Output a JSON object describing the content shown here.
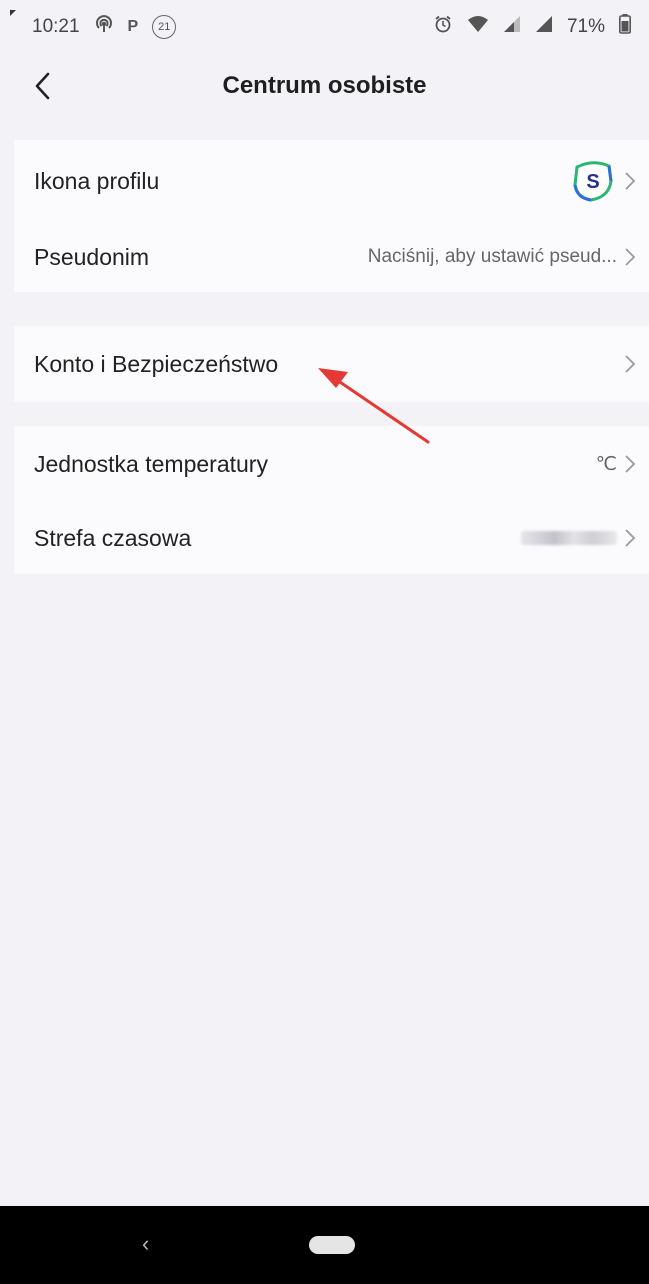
{
  "status_bar": {
    "time": "10:21",
    "left_icons": [
      "wifi-tethering-icon",
      "p-icon",
      "notification-21-icon"
    ],
    "p_glyph": "P",
    "badge_text": "21",
    "battery": "71%",
    "right_icons": [
      "alarm-icon",
      "wifi-icon",
      "signal-icon",
      "signal-icon",
      "battery-icon"
    ]
  },
  "header": {
    "title": "Centrum osobiste",
    "back_icon": "chevron-left-icon"
  },
  "sections": {
    "profile": {
      "avatar_row": {
        "label": "Ikona profilu",
        "avatar_letter": "S"
      },
      "nickname_row": {
        "label": "Pseudonim",
        "value": "Naciśnij, aby ustawić pseud..."
      }
    },
    "account": {
      "security_row": {
        "label": "Konto i Bezpieczeństwo"
      }
    },
    "settings": {
      "temperature_row": {
        "label": "Jednostka temperatury",
        "value": "℃"
      },
      "timezone_row": {
        "label": "Strefa czasowa"
      }
    }
  },
  "annotation": {
    "type": "arrow",
    "color": "#e53935",
    "points_to": "Konto i Bezpieczeństwo"
  },
  "nav_bar": {
    "back_glyph": "‹",
    "icons": [
      "back-icon",
      "home-pill-icon"
    ]
  }
}
